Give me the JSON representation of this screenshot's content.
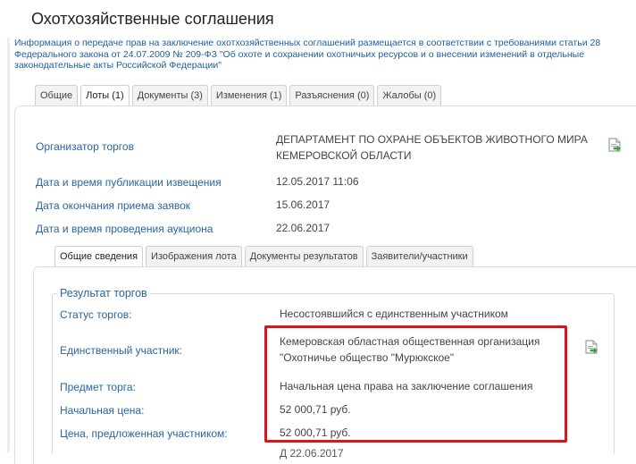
{
  "page": {
    "title": "Охотхозяйственные соглашения",
    "info": "Информация о передаче прав на заключение охотхозяйственных соглашений размещается в соответствии с требованиями статьи 28 Федерального закона от 24.07.2009 № 209-ФЗ \"Об охоте и сохранении охотничьих ресурсов и о внесении изменений в отдельные законодательные акты Российской Федерации\""
  },
  "tabs": [
    {
      "label": "Общие"
    },
    {
      "label": "Лоты (1)"
    },
    {
      "label": "Документы (3)"
    },
    {
      "label": "Изменения (1)"
    },
    {
      "label": "Разъяснения (0)"
    },
    {
      "label": "Жалобы (0)"
    }
  ],
  "lot": {
    "organizer_label": "Организатор торгов",
    "organizer_value": "ДЕПАРТАМЕНТ ПО ОХРАНЕ ОБЪЕКТОВ ЖИВОТНОГО МИРА КЕМЕРОВСКОЙ ОБЛАСТИ",
    "pub_label": "Дата и время публикации извещения",
    "pub_value": "12.05.2017 11:06",
    "end_label": "Дата окончания приема заявок",
    "end_value": "15.06.2017",
    "auction_label": "Дата и время проведения аукциона",
    "auction_value": "22.06.2017"
  },
  "sub_tabs": [
    {
      "label": "Общие сведения"
    },
    {
      "label": "Изображения лота"
    },
    {
      "label": "Документы результатов"
    },
    {
      "label": "Заявители/участники"
    }
  ],
  "result": {
    "legend": "Результат торгов",
    "status_label": "Статус торгов:",
    "status_value": "Несостоявшийся с единственным участником",
    "participant_label": "Единственный участник:",
    "participant_value": "Кемеровская областная общественная организация \"Охотничье общество \"Мурюкское\"",
    "subject_label": "Предмет торга:",
    "subject_value": "Начальная цена права на заключение соглашения",
    "initial_label": "Начальная цена:",
    "initial_value": "52 000,71 руб.",
    "offered_label": "Цена, предложенная участником:",
    "offered_value": "52 000,71 руб.",
    "cut_text": "Д             22.06.2017"
  },
  "icons": {
    "document": "document-export-icon"
  },
  "colors": {
    "link_blue": "#2b64a0",
    "highlight_red": "#d6161e"
  }
}
